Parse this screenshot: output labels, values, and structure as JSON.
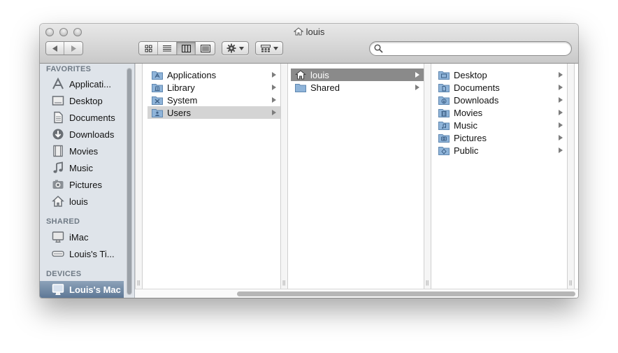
{
  "window": {
    "title": "louis"
  },
  "toolbar": {
    "back_icon": "back-arrow-icon",
    "forward_icon": "forward-arrow-icon",
    "views": [
      "icon-view-icon",
      "list-view-icon",
      "column-view-icon",
      "coverflow-view-icon"
    ],
    "active_view": "column-view-icon",
    "action_icon": "gear-icon",
    "arrange_icon": "arrange-icon",
    "search_placeholder": ""
  },
  "sidebar": {
    "favorites_title": "FAVORITES",
    "favorites": [
      {
        "label": "Applicati...",
        "icon": "applications-icon"
      },
      {
        "label": "Desktop",
        "icon": "desktop-icon"
      },
      {
        "label": "Documents",
        "icon": "documents-icon"
      },
      {
        "label": "Downloads",
        "icon": "downloads-icon"
      },
      {
        "label": "Movies",
        "icon": "movies-icon"
      },
      {
        "label": "Music",
        "icon": "music-icon"
      },
      {
        "label": "Pictures",
        "icon": "pictures-icon"
      },
      {
        "label": "louis",
        "icon": "home-icon"
      }
    ],
    "shared_title": "SHARED",
    "shared": [
      {
        "label": "iMac",
        "icon": "imac-icon"
      },
      {
        "label": "Louis's Ti...",
        "icon": "time-capsule-icon"
      }
    ],
    "devices_title": "DEVICES",
    "devices": [
      {
        "label": "Louis's Mac",
        "icon": "computer-icon",
        "selected": true
      }
    ]
  },
  "columns": [
    {
      "items": [
        {
          "label": "Applications",
          "icon": "folder-applications-icon",
          "selected": false
        },
        {
          "label": "Library",
          "icon": "folder-library-icon",
          "selected": false
        },
        {
          "label": "System",
          "icon": "folder-system-icon",
          "selected": false
        },
        {
          "label": "Users",
          "icon": "folder-users-icon",
          "selected": true
        }
      ]
    },
    {
      "items": [
        {
          "label": "louis",
          "icon": "home-icon",
          "selected": true
        },
        {
          "label": "Shared",
          "icon": "folder-icon",
          "selected": false
        }
      ]
    },
    {
      "items": [
        {
          "label": "Desktop",
          "icon": "folder-desktop-icon",
          "selected": false
        },
        {
          "label": "Documents",
          "icon": "folder-documents-icon",
          "selected": false
        },
        {
          "label": "Downloads",
          "icon": "folder-downloads-icon",
          "selected": false
        },
        {
          "label": "Movies",
          "icon": "folder-movies-icon",
          "selected": false
        },
        {
          "label": "Music",
          "icon": "folder-music-icon",
          "selected": false
        },
        {
          "label": "Pictures",
          "icon": "folder-pictures-icon",
          "selected": false
        },
        {
          "label": "Public",
          "icon": "folder-public-icon",
          "selected": false
        }
      ]
    }
  ],
  "colors": {
    "folder": "#8fb4d9",
    "sidebar_bg": "#dfe4ea",
    "selection_dark": "#8a8a8a",
    "selection_gray": "#d4d4d4"
  }
}
